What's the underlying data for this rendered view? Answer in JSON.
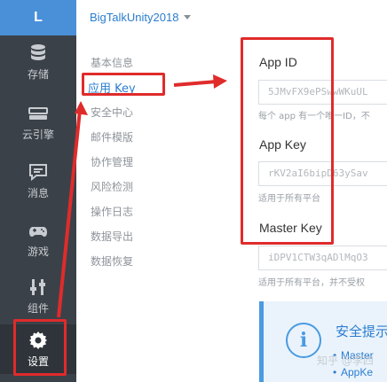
{
  "sidebar": {
    "logo": "L",
    "items": [
      {
        "label": "存储",
        "icon": "database-icon"
      },
      {
        "label": "云引擎",
        "icon": "server-icon"
      },
      {
        "label": "消息",
        "icon": "chat-icon"
      },
      {
        "label": "游戏",
        "icon": "gamepad-icon"
      },
      {
        "label": "组件",
        "icon": "sliders-icon"
      },
      {
        "label": "设置",
        "icon": "gear-icon"
      }
    ]
  },
  "header": {
    "app_name": "BigTalkUnity2018"
  },
  "settings_menu": [
    "基本信息",
    "应用 Key",
    "安全中心",
    "邮件模版",
    "协作管理",
    "风险检测",
    "操作日志",
    "数据导出",
    "数据恢复"
  ],
  "fields": {
    "app_id": {
      "label": "App ID",
      "value": "5JMvFX9ePSwwWKuUL",
      "help": "每个 app 有一个唯一ID，不"
    },
    "app_key": {
      "label": "App Key",
      "value": "rKV2aI6bipD63ySav",
      "help": "适用于所有平台"
    },
    "master_key": {
      "label": "Master Key",
      "value": "iDPV1CTW3qADlMqO3",
      "help": "适用于所有平台，并不受权"
    }
  },
  "tip": {
    "title": "安全提示",
    "lines": [
      "Master",
      "AppKe"
    ]
  },
  "watermark": "知乎 @李四",
  "colors": {
    "accent": "#2b7dcf",
    "annotation": "#e02b2b",
    "sidebar": "#3b4149"
  }
}
